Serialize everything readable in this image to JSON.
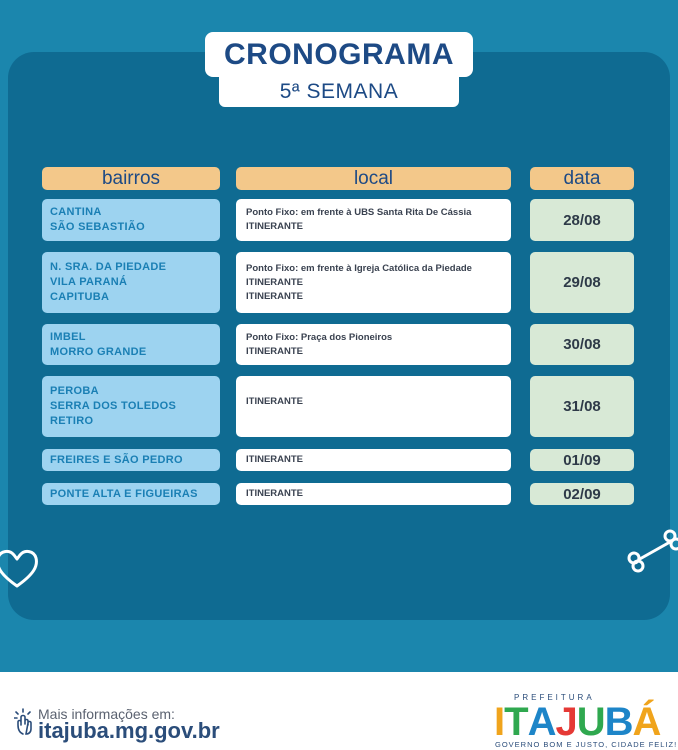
{
  "title": "CRONOGRAMA",
  "subtitle": "5ª SEMANA",
  "table": {
    "headers": {
      "bairros": "bairros",
      "local": "local",
      "data": "data"
    },
    "rows": [
      {
        "bairros": [
          "CANTINA",
          "SÃO SEBASTIÃO"
        ],
        "local": [
          "Ponto Fixo: em frente à UBS Santa Rita De Cássia",
          "ITINERANTE"
        ],
        "data": "28/08"
      },
      {
        "bairros": [
          "N. SRA. DA PIEDADE",
          "VILA PARANÁ",
          "CAPITUBA"
        ],
        "local": [
          "Ponto Fixo: em frente à Igreja Católica da Piedade",
          "ITINERANTE",
          "ITINERANTE"
        ],
        "data": "29/08"
      },
      {
        "bairros": [
          "IMBEL",
          "MORRO GRANDE"
        ],
        "local": [
          "Ponto Fixo: Praça dos Pioneiros",
          "ITINERANTE"
        ],
        "data": "30/08"
      },
      {
        "bairros": [
          "PEROBA",
          "SERRA DOS TOLEDOS",
          "RETIRO"
        ],
        "local": [
          "ITINERANTE"
        ],
        "data": "31/08"
      },
      {
        "bairros": [
          "FREIRES E SÃO PEDRO"
        ],
        "local": [
          "ITINERANTE"
        ],
        "data": "01/09"
      },
      {
        "bairros": [
          "PONTE ALTA E FIGUEIRAS"
        ],
        "local": [
          "ITINERANTE"
        ],
        "data": "02/09"
      }
    ]
  },
  "footer": {
    "more_info_label": "Mais informações em:",
    "url": "itajuba.mg.gov.br",
    "logo_top": "PREFEITURA",
    "logo_letters": [
      "I",
      "T",
      "A",
      "J",
      "U",
      "B",
      "Á"
    ],
    "logo_colors": [
      "#f0a41c",
      "#2fa84f",
      "#1d85c8",
      "#e53935",
      "#2fa84f",
      "#1d85c8",
      "#f0a41c"
    ],
    "logo_tagline": "GOVERNO BOM E JUSTO, CIDADE FELIZ!"
  },
  "colors": {
    "background": "#1b86ad",
    "panel": "#0f6b92",
    "header_cells": "#f3c88a",
    "bairro_cells": "#9dd3f0",
    "local_cells": "#ffffff",
    "data_cells": "#d8e9d6",
    "title_text": "#1d4a85"
  },
  "icons": [
    "heart-icon",
    "bone-icon",
    "touch-icon"
  ]
}
